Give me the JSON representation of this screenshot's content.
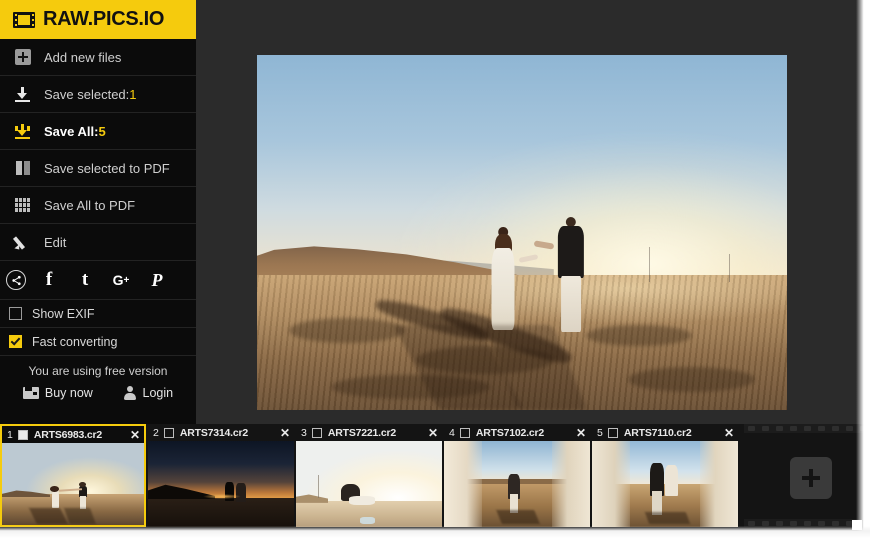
{
  "brand": {
    "name": "RAW.PICS.IO",
    "icon": "film-strip-icon",
    "bg_color": "#f5cb0d"
  },
  "sidebar": {
    "items": [
      {
        "label": "Add new files",
        "icon": "plus-box-icon",
        "active": false
      },
      {
        "label": "Save selected: ",
        "count": "1",
        "icon": "download-icon",
        "active": false
      },
      {
        "label": "Save All: ",
        "count": "5",
        "icon": "download-all-icon",
        "active": true
      },
      {
        "label": "Save selected to PDF",
        "icon": "two-bars-icon",
        "active": false
      },
      {
        "label": "Save All to PDF",
        "icon": "grid-icon",
        "active": false
      },
      {
        "label": "Edit",
        "icon": "pencil-icon",
        "active": false
      }
    ],
    "social": [
      {
        "name": "share-icon",
        "glyph": "≪"
      },
      {
        "name": "facebook-icon",
        "glyph": "f"
      },
      {
        "name": "tumblr-icon",
        "glyph": "t"
      },
      {
        "name": "google-plus-icon",
        "glyph": "G+"
      },
      {
        "name": "pinterest-icon",
        "glyph": "ᴩ"
      }
    ],
    "options": [
      {
        "label": "Show EXIF",
        "checked": false
      },
      {
        "label": "Fast converting",
        "checked": true
      }
    ],
    "free_version_note": "You are using free version",
    "buy_now_label": "Buy now",
    "login_label": "Login",
    "accent_color": "#f5cb0d"
  },
  "viewer": {
    "current_image": "ARTS6983.cr2",
    "description": "Couple holding hands walking on sand dunes at sunset"
  },
  "filmstrip": {
    "add_button_label": "+",
    "close_glyph": "✕",
    "thumbs": [
      {
        "index": "1",
        "name": "ARTS6983.cr2",
        "selected": true,
        "checked": true
      },
      {
        "index": "2",
        "name": "ARTS7314.cr2",
        "selected": false,
        "checked": false
      },
      {
        "index": "3",
        "name": "ARTS7221.cr2",
        "selected": false,
        "checked": false
      },
      {
        "index": "4",
        "name": "ARTS7102.cr2",
        "selected": false,
        "checked": false
      },
      {
        "index": "5",
        "name": "ARTS7110.cr2",
        "selected": false,
        "checked": false
      }
    ]
  }
}
